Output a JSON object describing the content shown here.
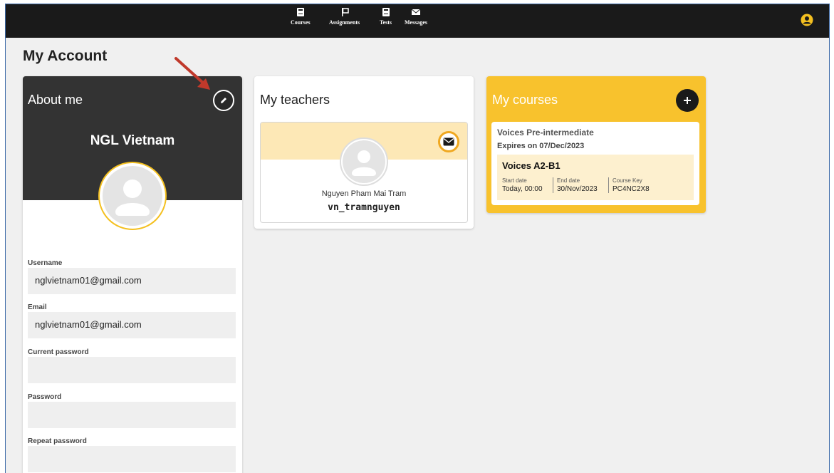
{
  "nav": {
    "items": [
      {
        "label": "Courses",
        "icon": "book-icon"
      },
      {
        "label": "Assignments",
        "icon": "flag-icon"
      },
      {
        "label": "Tests",
        "icon": "book-icon"
      },
      {
        "label": "Messages",
        "icon": "envelope-icon"
      }
    ],
    "user_icon": "user-circle-icon"
  },
  "page": {
    "title": "My Account"
  },
  "about": {
    "title": "About me",
    "name": "NGL Vietnam",
    "fields": [
      {
        "label": "Username",
        "value": "nglvietnam01@gmail.com"
      },
      {
        "label": "Email",
        "value": "nglvietnam01@gmail.com"
      },
      {
        "label": "Current password",
        "value": ""
      },
      {
        "label": "Password",
        "value": ""
      },
      {
        "label": "Repeat password",
        "value": ""
      }
    ]
  },
  "teachers": {
    "title": "My teachers",
    "list": [
      {
        "name": "Nguyen Pham Mai Tram",
        "username": "vn_tramnguyen"
      }
    ]
  },
  "courses": {
    "title": "My courses",
    "list": [
      {
        "name": "Voices Pre-intermediate",
        "expires": "Expires on 07/Dec/2023",
        "class_name": "Voices A2-B1",
        "start_label": "Start date",
        "start_value": "Today, 00:00",
        "end_label": "End date",
        "end_value": "30/Nov/2023",
        "key_label": "Course Key",
        "key_value": "PC4NC2X8"
      }
    ]
  },
  "colors": {
    "topbar": "#1a1a1a",
    "about_header": "#333333",
    "courses_bg": "#f8c22d",
    "accent_yellow": "#f4c020",
    "annotation_arrow": "#c0392b"
  }
}
